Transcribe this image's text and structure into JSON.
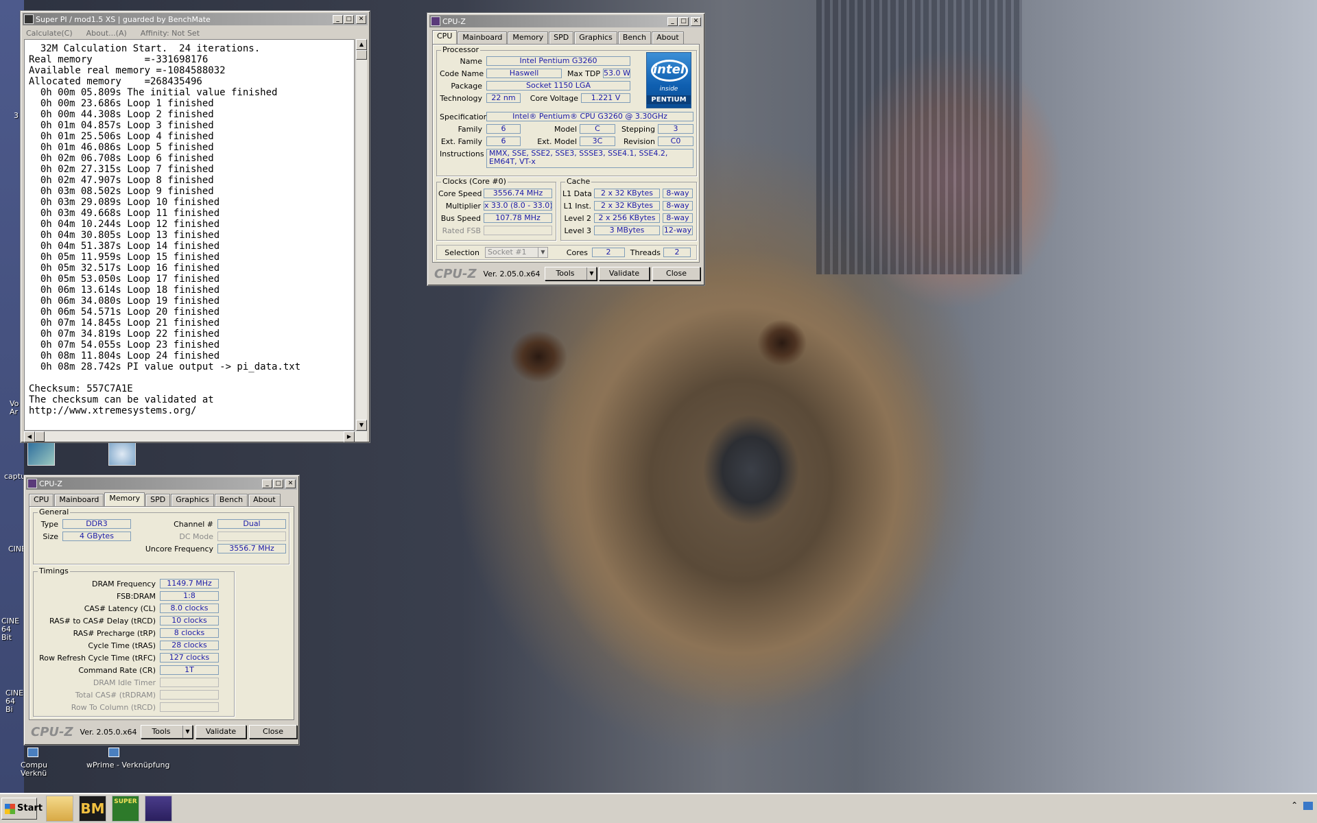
{
  "desktop": {
    "icons": [
      {
        "label": "captu"
      },
      {
        "label": "CINE"
      },
      {
        "label": "CINE 64 Bit"
      },
      {
        "label": "CINE 64 Bi"
      },
      {
        "label": "Compu Verknü"
      },
      {
        "label": "wPrime - Verknüpfung"
      },
      {
        "label": "Vo Ar"
      },
      {
        "label": "3"
      }
    ]
  },
  "superpi": {
    "title": "Super PI / mod1.5 XS | guarded by BenchMate",
    "menu": [
      "Calculate(C)",
      "About...(A)",
      "Affinity: Not Set"
    ],
    "lines": [
      "  32M Calculation Start.  24 iterations.",
      "Real memory         =-331698176",
      "Available real memory =-1084588032",
      "Allocated memory    =268435496",
      "  0h 00m 05.809s The initial value finished",
      "  0h 00m 23.686s Loop 1 finished",
      "  0h 00m 44.308s Loop 2 finished",
      "  0h 01m 04.857s Loop 3 finished",
      "  0h 01m 25.506s Loop 4 finished",
      "  0h 01m 46.086s Loop 5 finished",
      "  0h 02m 06.708s Loop 6 finished",
      "  0h 02m 27.315s Loop 7 finished",
      "  0h 02m 47.907s Loop 8 finished",
      "  0h 03m 08.502s Loop 9 finished",
      "  0h 03m 29.089s Loop 10 finished",
      "  0h 03m 49.668s Loop 11 finished",
      "  0h 04m 10.244s Loop 12 finished",
      "  0h 04m 30.805s Loop 13 finished",
      "  0h 04m 51.387s Loop 14 finished",
      "  0h 05m 11.959s Loop 15 finished",
      "  0h 05m 32.517s Loop 16 finished",
      "  0h 05m 53.050s Loop 17 finished",
      "  0h 06m 13.614s Loop 18 finished",
      "  0h 06m 34.080s Loop 19 finished",
      "  0h 06m 54.571s Loop 20 finished",
      "  0h 07m 14.845s Loop 21 finished",
      "  0h 07m 34.819s Loop 22 finished",
      "  0h 07m 54.055s Loop 23 finished",
      "  0h 08m 11.804s Loop 24 finished",
      "  0h 08m 28.742s PI value output -> pi_data.txt",
      "",
      "Checksum: 557C7A1E",
      "The checksum can be validated at",
      "http://www.xtremesystems.org/"
    ]
  },
  "cpuz_cpu": {
    "title": "CPU-Z",
    "tabs": [
      "CPU",
      "Mainboard",
      "Memory",
      "SPD",
      "Graphics",
      "Bench",
      "About"
    ],
    "active_tab": "CPU",
    "processor": {
      "legend": "Processor",
      "name_label": "Name",
      "name": "Intel Pentium G3260",
      "codename_label": "Code Name",
      "codename": "Haswell",
      "maxtdp_label": "Max TDP",
      "maxtdp": "53.0 W",
      "package_label": "Package",
      "package": "Socket 1150 LGA",
      "technology_label": "Technology",
      "technology": "22 nm",
      "corevoltage_label": "Core Voltage",
      "corevoltage": "1.221 V",
      "spec_label": "Specification",
      "spec": "Intel® Pentium® CPU G3260 @ 3.30GHz",
      "family_label": "Family",
      "family": "6",
      "model_label": "Model",
      "model": "C",
      "stepping_label": "Stepping",
      "stepping": "3",
      "extfamily_label": "Ext. Family",
      "extfamily": "6",
      "extmodel_label": "Ext. Model",
      "extmodel": "3C",
      "revision_label": "Revision",
      "revision": "C0",
      "instructions_label": "Instructions",
      "instructions": "MMX, SSE, SSE2, SSE3, SSSE3, SSE4.1, SSE4.2, EM64T, VT-x",
      "logo": {
        "brand": "intel",
        "inside": "inside",
        "line": "PENTIUM"
      }
    },
    "clocks": {
      "legend": "Clocks (Core #0)",
      "corespeed_label": "Core Speed",
      "corespeed": "3556.74 MHz",
      "multiplier_label": "Multiplier",
      "multiplier": "x 33.0 (8.0 - 33.0)",
      "busspeed_label": "Bus Speed",
      "busspeed": "107.78 MHz",
      "ratedfsb_label": "Rated FSB",
      "ratedfsb": ""
    },
    "cache": {
      "legend": "Cache",
      "l1d_label": "L1 Data",
      "l1d": "2 x 32 KBytes",
      "l1d_way": "8-way",
      "l1i_label": "L1 Inst.",
      "l1i": "2 x 32 KBytes",
      "l1i_way": "8-way",
      "l2_label": "Level 2",
      "l2": "2 x 256 KBytes",
      "l2_way": "8-way",
      "l3_label": "Level 3",
      "l3": "3 MBytes",
      "l3_way": "12-way"
    },
    "selection_label": "Selection",
    "selection": "Socket #1",
    "cores_label": "Cores",
    "cores": "2",
    "threads_label": "Threads",
    "threads": "2",
    "footer": {
      "logo": "CPU-Z",
      "version": "Ver. 2.05.0.x64",
      "tools": "Tools",
      "validate": "Validate",
      "close": "Close"
    }
  },
  "cpuz_mem": {
    "title": "CPU-Z",
    "tabs": [
      "CPU",
      "Mainboard",
      "Memory",
      "SPD",
      "Graphics",
      "Bench",
      "About"
    ],
    "active_tab": "Memory",
    "general": {
      "legend": "General",
      "type_label": "Type",
      "type": "DDR3",
      "size_label": "Size",
      "size": "4 GBytes",
      "channel_label": "Channel #",
      "channel": "Dual",
      "dcmode_label": "DC Mode",
      "dcmode": "",
      "uncore_label": "Uncore Frequency",
      "uncore": "3556.7 MHz"
    },
    "timings": {
      "legend": "Timings",
      "rows": [
        {
          "label": "DRAM Frequency",
          "value": "1149.7 MHz",
          "dim": false
        },
        {
          "label": "FSB:DRAM",
          "value": "1:8",
          "dim": false
        },
        {
          "label": "CAS# Latency (CL)",
          "value": "8.0 clocks",
          "dim": false
        },
        {
          "label": "RAS# to CAS# Delay (tRCD)",
          "value": "10 clocks",
          "dim": false
        },
        {
          "label": "RAS# Precharge (tRP)",
          "value": "8 clocks",
          "dim": false
        },
        {
          "label": "Cycle Time (tRAS)",
          "value": "28 clocks",
          "dim": false
        },
        {
          "label": "Row Refresh Cycle Time (tRFC)",
          "value": "127 clocks",
          "dim": false
        },
        {
          "label": "Command Rate (CR)",
          "value": "1T",
          "dim": false
        },
        {
          "label": "DRAM Idle Timer",
          "value": "",
          "dim": true
        },
        {
          "label": "Total CAS# (tRDRAM)",
          "value": "",
          "dim": true
        },
        {
          "label": "Row To Column (tRCD)",
          "value": "",
          "dim": true
        }
      ]
    },
    "footer": {
      "logo": "CPU-Z",
      "version": "Ver. 2.05.0.x64",
      "tools": "Tools",
      "validate": "Validate",
      "close": "Close"
    }
  },
  "taskbar": {
    "start_label": "Start",
    "apps": [
      {
        "name": "explorer-app",
        "label": ""
      },
      {
        "name": "benchmate-app",
        "label": "BM"
      },
      {
        "name": "superpi-app",
        "label": "SUPER"
      },
      {
        "name": "cpuz-app",
        "label": ""
      }
    ]
  }
}
